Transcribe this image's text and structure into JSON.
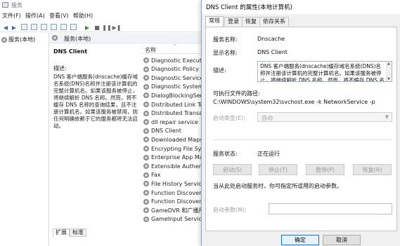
{
  "services_window": {
    "title": "服务",
    "menu": [
      "文件(F)",
      "操作(A)",
      "查看(V)",
      "帮助(H)"
    ],
    "tree_item": "服务(本地)",
    "pane_header": "服务(本地)",
    "selected_service": {
      "name": "DNS Client",
      "description_label": "描述:",
      "description": "DNS 客户端服务(dnscache)缓存域名系统(DNS)名称并注册该计算机的完整计算机名。如果该服务被停止，将继续解析 DNS 名称。然而，将不缓存 DNS 名称的查询结果，且不注册计算机名。如果该服务被禁用，则任何明确依赖于它的服务都将无法启动。"
    },
    "list": {
      "column_name": "名称",
      "items": [
        "Diagnostic Execution Service",
        "Diagnostic Policy Service",
        "Diagnostic Service Host",
        "Diagnostic System Host",
        "DialogBlockingService",
        "Distributed Link Tracking Client",
        "Distributed Transaction Coordinator",
        "dll repair service",
        "DNS Client",
        "Downloaded Maps Manager",
        "Encrypting File System (EFS)",
        "Enterprise App Management Service",
        "Extensible Authentication Protocol",
        "Fax",
        "File History Service",
        "Function Discovery Provider Host",
        "Function Discovery Resource Publication",
        "GameDVR 和广播用户服务",
        "GameInput Service"
      ]
    },
    "bottom_tabs": [
      "扩展",
      "标准"
    ]
  },
  "dialog": {
    "title": "DNS Client 的属性(本地计算机)",
    "tabs": [
      "常规",
      "登录",
      "恢复",
      "依存关系"
    ],
    "service_name_label": "服务名称:",
    "service_name": "Dnscache",
    "display_name_label": "显示名称:",
    "display_name": "DNS Client",
    "description_label": "描述:",
    "description": "DNS 客户端服务(dnscache)缓存域名系统(DNS)名称并注册该计算机的完整计算机名。如果该服务被停止，将继续解析 DNS 名称。然而，将不缓存 DNS 名称的查询结果，且不注册计算机名。",
    "exe_path_label": "可执行文件的路径:",
    "exe_path": "C:\\WINDOWS\\system32\\svchost.exe -k NetworkService -p",
    "startup_type_label": "启动类型(E):",
    "startup_type_value": "自动",
    "status_label": "服务状态:",
    "status_value": "正在运行",
    "buttons": {
      "start": "启动(S)",
      "stop": "停止(T)",
      "pause": "暂停(P)",
      "resume": "恢复(R)"
    },
    "hint": "当从此处启动服务时，你可指定所适用的启动参数。",
    "start_params_label": "启动参数(M):",
    "start_params_value": "",
    "footer": {
      "ok": "确定",
      "cancel": "取消"
    }
  }
}
